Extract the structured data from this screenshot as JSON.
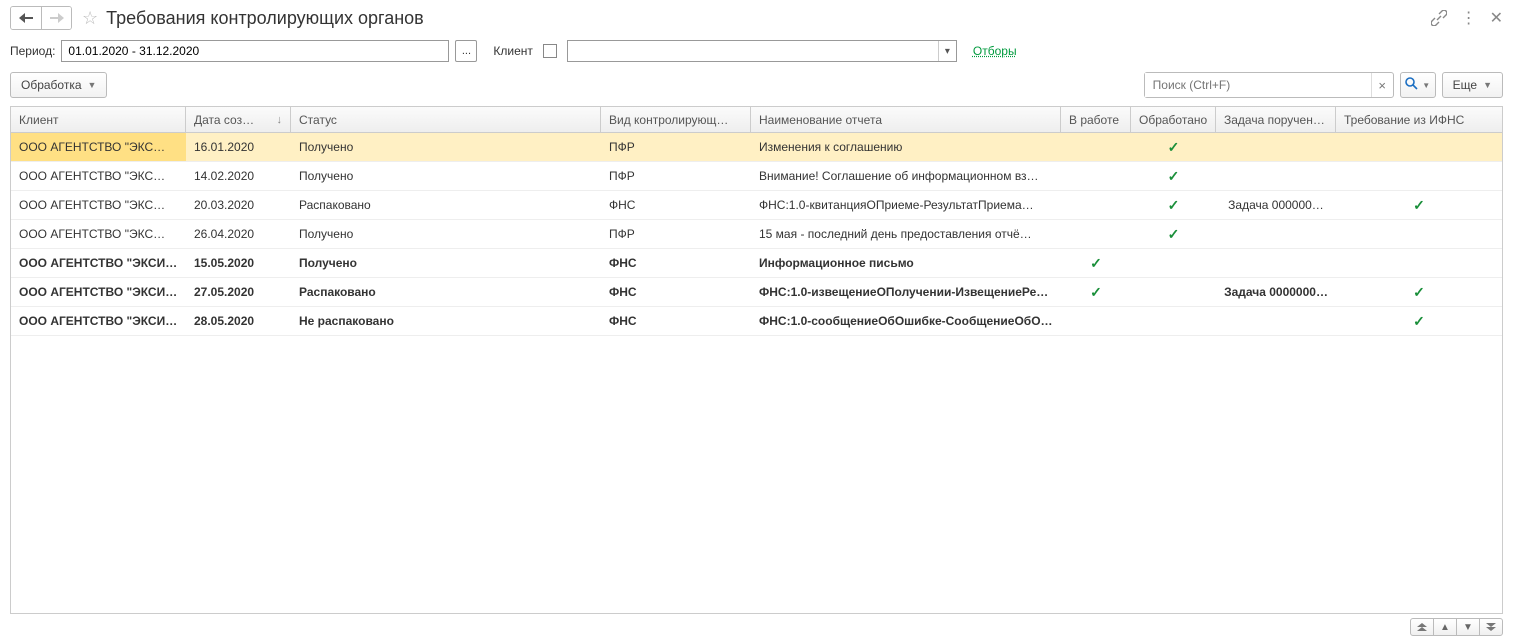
{
  "title": "Требования контролирующих органов",
  "labels": {
    "period": "Период:",
    "client": "Клиент",
    "filters_link": "Отборы"
  },
  "period_value": "01.01.2020 - 31.12.2020",
  "period_select_btn": "...",
  "client_value": "",
  "toolbar": {
    "process_label": "Обработка",
    "search_placeholder": "Поиск (Ctrl+F)",
    "more_label": "Еще"
  },
  "columns": [
    "Клиент",
    "Дата соз…",
    "Статус",
    "Вид контролирующ…",
    "Наименование отчета",
    "В работе",
    "Обработано",
    "Задача поручен…",
    "Требование из ИФНС"
  ],
  "sort_indicator": "↓",
  "rows": [
    {
      "client": "ООО АГЕНТСТВО \"ЭКС…",
      "date": "16.01.2020",
      "status": "Получено",
      "authority": "ПФР",
      "report": "Изменения к соглашению",
      "in_work": false,
      "processed": true,
      "task": "",
      "ifns": false,
      "bold": false,
      "selected": true
    },
    {
      "client": "ООО АГЕНТСТВО \"ЭКС…",
      "date": "14.02.2020",
      "status": "Получено",
      "authority": "ПФР",
      "report": "Внимание! Соглашение об информационном вз…",
      "in_work": false,
      "processed": true,
      "task": "",
      "ifns": false,
      "bold": false,
      "selected": false
    },
    {
      "client": "ООО АГЕНТСТВО \"ЭКС…",
      "date": "20.03.2020",
      "status": "Распаковано",
      "authority": "ФНС",
      "report": "ФНС:1.0-квитанцияОПриеме-РезультатПриема…",
      "in_work": false,
      "processed": true,
      "task": "Задача 000000…",
      "ifns": true,
      "bold": false,
      "selected": false
    },
    {
      "client": "ООО АГЕНТСТВО \"ЭКС…",
      "date": "26.04.2020",
      "status": "Получено",
      "authority": "ПФР",
      "report": "15 мая - последний день предоставления отчё…",
      "in_work": false,
      "processed": true,
      "task": "",
      "ifns": false,
      "bold": false,
      "selected": false
    },
    {
      "client": "ООО АГЕНТСТВО \"ЭКСИ…",
      "date": "15.05.2020",
      "status": "Получено",
      "authority": "ФНС",
      "report": "Информационное письмо",
      "in_work": true,
      "processed": false,
      "task": "",
      "ifns": false,
      "bold": true,
      "selected": false
    },
    {
      "client": "ООО АГЕНТСТВО \"ЭКСИ…",
      "date": "27.05.2020",
      "status": "Распаковано",
      "authority": "ФНС",
      "report": "ФНС:1.0-извещениеОПолучении-ИзвещениеРе…",
      "in_work": true,
      "processed": false,
      "task": "Задача 0000000…",
      "ifns": true,
      "bold": true,
      "selected": false
    },
    {
      "client": "ООО АГЕНТСТВО \"ЭКСИ…",
      "date": "28.05.2020",
      "status": "Не  распаковано",
      "authority": "ФНС",
      "report": "ФНС:1.0-сообщениеОбОшибке-СообщениеОбО…",
      "in_work": false,
      "processed": false,
      "task": "",
      "ifns": true,
      "bold": true,
      "selected": false
    }
  ]
}
